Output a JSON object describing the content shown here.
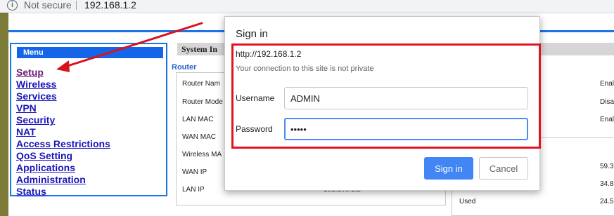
{
  "browser": {
    "info_icon_char": "i",
    "security_text": "Not secure",
    "url": "192.168.1.2"
  },
  "menu": {
    "header": "Menu",
    "items": [
      {
        "label": "Setup",
        "visited": true
      },
      {
        "label": "Wireless"
      },
      {
        "label": "Services"
      },
      {
        "label": "VPN"
      },
      {
        "label": "Security"
      },
      {
        "label": "NAT"
      },
      {
        "label": "Access Restrictions"
      },
      {
        "label": "QoS Setting"
      },
      {
        "label": "Applications"
      },
      {
        "label": "Administration"
      },
      {
        "label": "Status"
      }
    ]
  },
  "page": {
    "system_header": "System In",
    "router_title": "Router",
    "router_rows": [
      {
        "label": "Router Nam"
      },
      {
        "label": "Router Mode"
      },
      {
        "label": "LAN MAC"
      },
      {
        "label": "WAN MAC"
      },
      {
        "label": "Wireless MA"
      },
      {
        "label": "WAN IP"
      },
      {
        "label": "LAN IP",
        "value": "192.168.1.2"
      }
    ],
    "right_values": [
      "Enal",
      "Disa",
      "Enal",
      "59.3",
      "34.8",
      "24.5"
    ],
    "used_label": "Used"
  },
  "dialog": {
    "title": "Sign in",
    "url": "http://192.168.1.2",
    "warning": "Your connection to this site is not private",
    "username_label": "Username",
    "username_value": "ADMIN",
    "password_label": "Password",
    "password_value": "•••••",
    "signin_label": "Sign in",
    "cancel_label": "Cancel"
  },
  "colors": {
    "menu_border": "#1a73e8",
    "menu_link": "#1a15b7",
    "menu_link_visited": "#6b1a74",
    "highlight_box": "#e0141f",
    "annotation_arrow": "#d8131c",
    "primary_button": "#4285f4"
  }
}
